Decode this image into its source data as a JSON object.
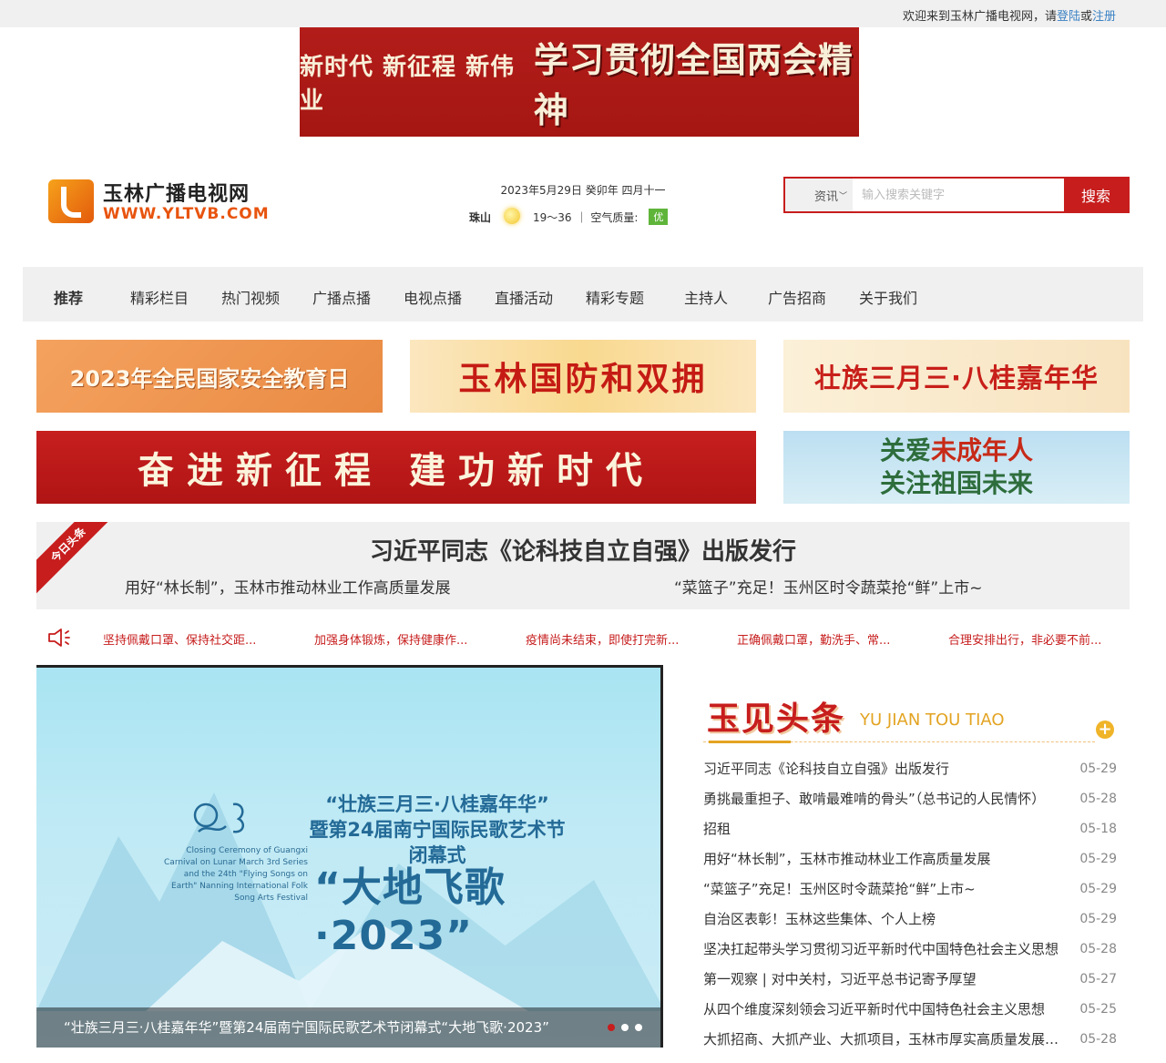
{
  "topbar": {
    "welcome_text": "欢迎来到玉林广播电视网，请",
    "login": "登陆",
    "or": "或",
    "register": "注册"
  },
  "top_banner": {
    "line1": "新时代 新征程 新伟业",
    "line2": "学习贯彻全国两会精神"
  },
  "logo": {
    "name": "玉林广播电视网",
    "url": "WWW.YLTVB.COM"
  },
  "date": "2023年5月29日 癸卯年 四月十一",
  "weather": {
    "city": "珠山",
    "temp": "19～36",
    "aq_label": "｜ 空气质量:",
    "aq_value": "优"
  },
  "search": {
    "category": "资讯",
    "placeholder": "输入搜索关键字",
    "button": "搜索"
  },
  "nav": [
    {
      "label": "推荐"
    },
    {
      "label": "精彩栏目"
    },
    {
      "label": "热门视频"
    },
    {
      "label": "广播点播"
    },
    {
      "label": "电视点播"
    },
    {
      "label": "直播活动"
    },
    {
      "label": "精彩专题"
    },
    {
      "label": "主持人"
    },
    {
      "label": "广告招商"
    },
    {
      "label": "关于我们"
    }
  ],
  "ads": {
    "a1": "2023年全民国家安全教育日",
    "a2": "玉林国防和双拥",
    "a3": "壮族三月三·八桂嘉年华",
    "a4": "奋进新征程  建功新时代",
    "a5_line1_pre": "关爱",
    "a5_line1_hl": "未成年人",
    "a5_line2": "关注祖国未来"
  },
  "headline": {
    "ribbon": "今日头条",
    "main": "习近平同志《论科技自立自强》出版发行",
    "sub1": "用好“林长制”，玉林市推动林业工作高质量发展",
    "sub2": "“菜篮子”充足！玉州区时令蔬菜抢“鲜”上市~"
  },
  "notices": [
    "坚持佩戴口罩、保持社交距...",
    "加强身体锻炼，保持健康作...",
    "疫情尚未结束，即使打完新...",
    "正确佩戴口罩，勤洗手、常...",
    "合理安排出行，非必要不前..."
  ],
  "slider": {
    "zh_title_1": "“壮族三月三·八桂嘉年华”",
    "zh_title_2": "暨第24届南宁国际民歌艺术节闭幕式",
    "zh_title_3": "“大地飞歌·2023”",
    "en_text": "Closing Ceremony of Guangxi Carnival on Lunar March 3rd Series and the 24th \"Flying Songs on Earth\" Nanning International Folk Song Arts Festival",
    "caption": "“壮族三月三·八桂嘉年华”暨第24届南宁国际民歌艺术节闭幕式“大地飞歌·2023”"
  },
  "side": {
    "title": "玉见头条",
    "title_en": "YU JIAN TOU TIAO",
    "items": [
      {
        "title": "习近平同志《论科技自立自强》出版发行",
        "date": "05-29"
      },
      {
        "title": "勇挑最重担子、敢啃最难啃的骨头”（总书记的人民情怀）",
        "date": "05-28"
      },
      {
        "title": "招租",
        "date": "05-18"
      },
      {
        "title": "用好“林长制”，玉林市推动林业工作高质量发展",
        "date": "05-29"
      },
      {
        "title": "“菜篮子”充足！玉州区时令蔬菜抢“鲜”上市~",
        "date": "05-29"
      },
      {
        "title": "自治区表彰！玉林这些集体、个人上榜",
        "date": "05-29"
      },
      {
        "title": "坚决扛起带头学习贯彻习近平新时代中国特色社会主义思想",
        "date": "05-28"
      },
      {
        "title": "第一观察 | 对中关村，习近平总书记寄予厚望",
        "date": "05-27"
      },
      {
        "title": "从四个维度深刻领会习近平新时代中国特色社会主义思想",
        "date": "05-25"
      },
      {
        "title": "大抓招商、大抓产业、大抓项目，玉林市厚实高质量发展基础",
        "date": "05-28"
      }
    ]
  },
  "colors": {
    "brand_red": "#c71d1d",
    "accent_orange": "#e8540f",
    "link_blue": "#3b82c4"
  }
}
